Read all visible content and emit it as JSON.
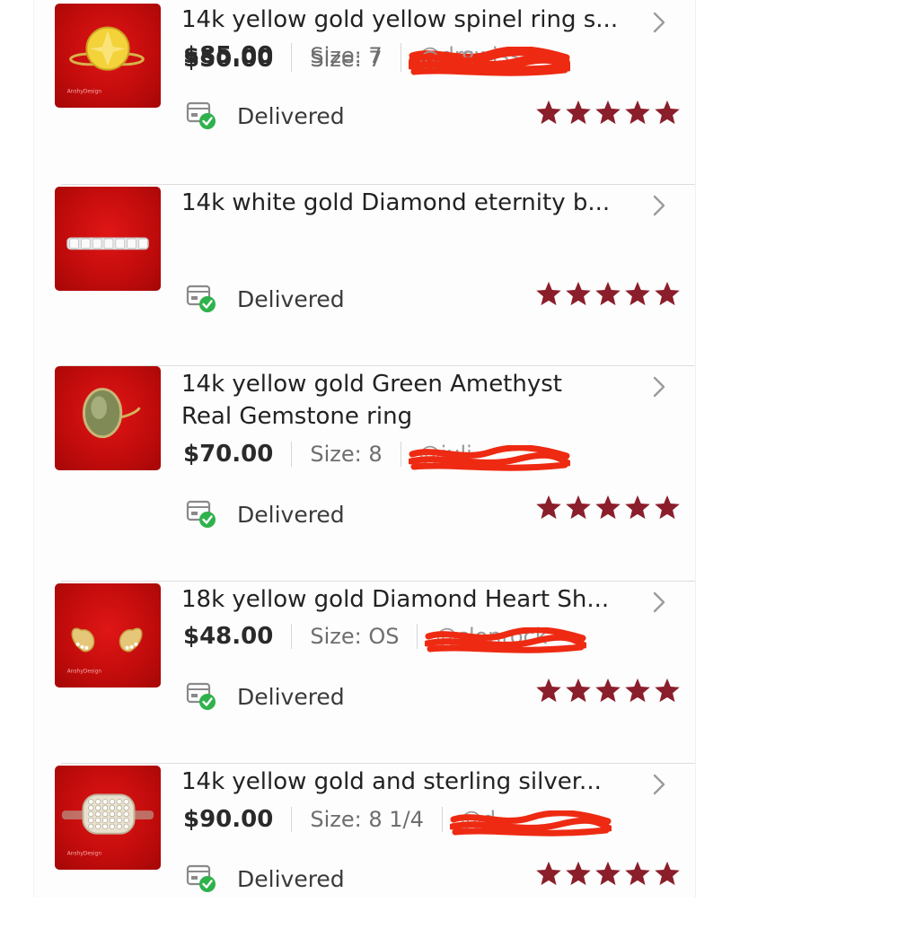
{
  "orders": [
    {
      "title": "14k yellow gold yellow spinel ring s...",
      "price": "$85.00",
      "size": "Size: 7",
      "seller": "@drswiss",
      "status": "Delivered",
      "rating": 5,
      "thumb_icon": "yellow-gem-ring",
      "thumb_brand": "AnshyDesign"
    },
    {
      "title": "14k white gold Diamond eternity b...",
      "price": "$50.00",
      "size": "Size: 7",
      "seller": "@...8",
      "status": "Delivered",
      "rating": 5,
      "thumb_icon": "diamond-band-ring",
      "thumb_brand": ""
    },
    {
      "title": "14k yellow gold Green Amethyst Real Gemstone ring",
      "price": "$70.00",
      "size": "Size: 8",
      "seller": "@juli",
      "status": "Delivered",
      "rating": 5,
      "thumb_icon": "green-gem-ring",
      "thumb_brand": ""
    },
    {
      "title": "18k yellow gold Diamond Heart Sh...",
      "price": "$48.00",
      "size": "Size: OS",
      "seller": "@slonrock",
      "status": "Delivered",
      "rating": 5,
      "thumb_icon": "heart-earrings",
      "thumb_brand": "AnshyDesign"
    },
    {
      "title": "14k yellow gold and sterling silver...",
      "price": "$90.00",
      "size": "Size: 8 1/4",
      "seller": "@d",
      "status": "Delivered",
      "rating": 5,
      "thumb_icon": "pave-diamond-ring",
      "thumb_brand": "AnshyDesign"
    }
  ],
  "colors": {
    "star": "#8b1e2b",
    "delivered_check": "#2fb24c",
    "thumb_bg": "#c40c0c",
    "redaction": "#ee2a12"
  },
  "icons": {
    "chevron": "chevron-right-icon",
    "status": "package-delivered-icon",
    "star": "star-icon"
  }
}
